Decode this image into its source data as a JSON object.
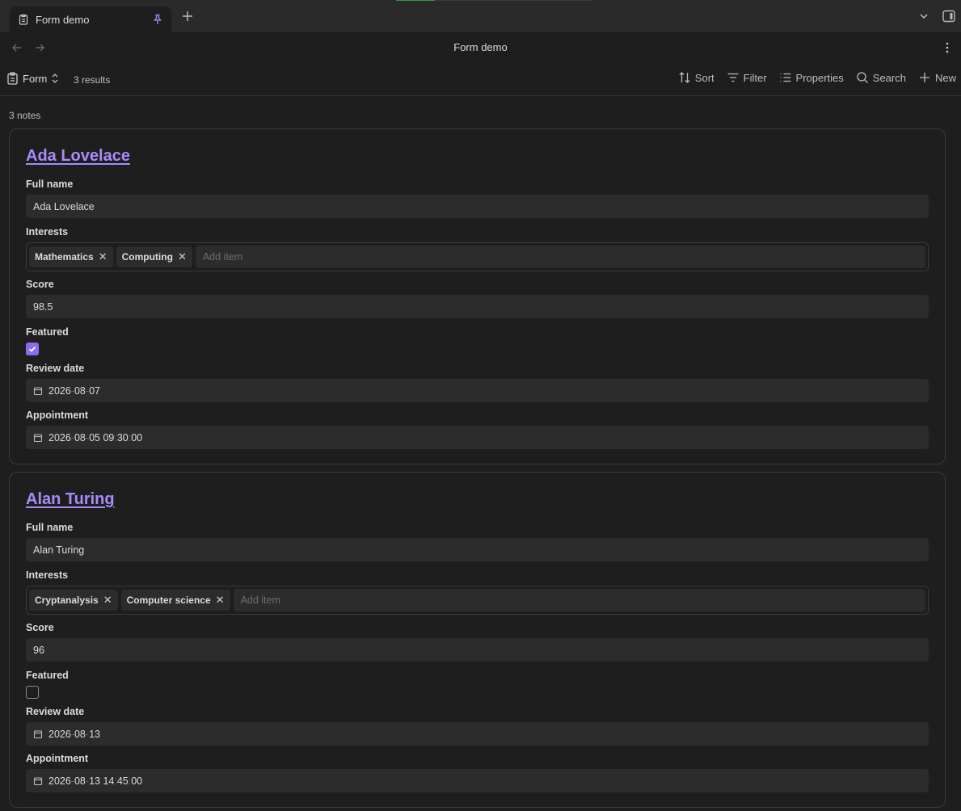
{
  "tab": {
    "title": "Form demo"
  },
  "header": {
    "title": "Form demo"
  },
  "toolbar": {
    "view_label": "Form",
    "results": "3 results",
    "sort": "Sort",
    "filter": "Filter",
    "properties": "Properties",
    "search": "Search",
    "new": "New"
  },
  "count": "3 notes",
  "labels": {
    "full_name": "Full name",
    "interests": "Interests",
    "score": "Score",
    "featured": "Featured",
    "review_date": "Review date",
    "appointment": "Appointment",
    "add_item": "Add item"
  },
  "cards": [
    {
      "title": "Ada Lovelace",
      "full_name": "Ada Lovelace",
      "interests": [
        "Mathematics",
        "Computing"
      ],
      "score": "98.5",
      "featured": true,
      "review_date": {
        "y": "2026",
        "m": "08",
        "d": "07"
      },
      "appointment": {
        "y": "2026",
        "m": "08",
        "d": "05",
        "hh": "09",
        "mm": "30",
        "ss": "00"
      }
    },
    {
      "title": "Alan Turing",
      "full_name": "Alan Turing",
      "interests": [
        "Cryptanalysis",
        "Computer science"
      ],
      "score": "96",
      "featured": false,
      "review_date": {
        "y": "2026",
        "m": "08",
        "d": "13"
      },
      "appointment": {
        "y": "2026",
        "m": "08",
        "d": "13",
        "hh": "14",
        "mm": "45",
        "ss": "00"
      }
    }
  ],
  "colors": {
    "accent": "#a88bfa",
    "checkbox": "#8b6cf0",
    "background": "#1e1e1e",
    "input": "#2c2c2c"
  }
}
